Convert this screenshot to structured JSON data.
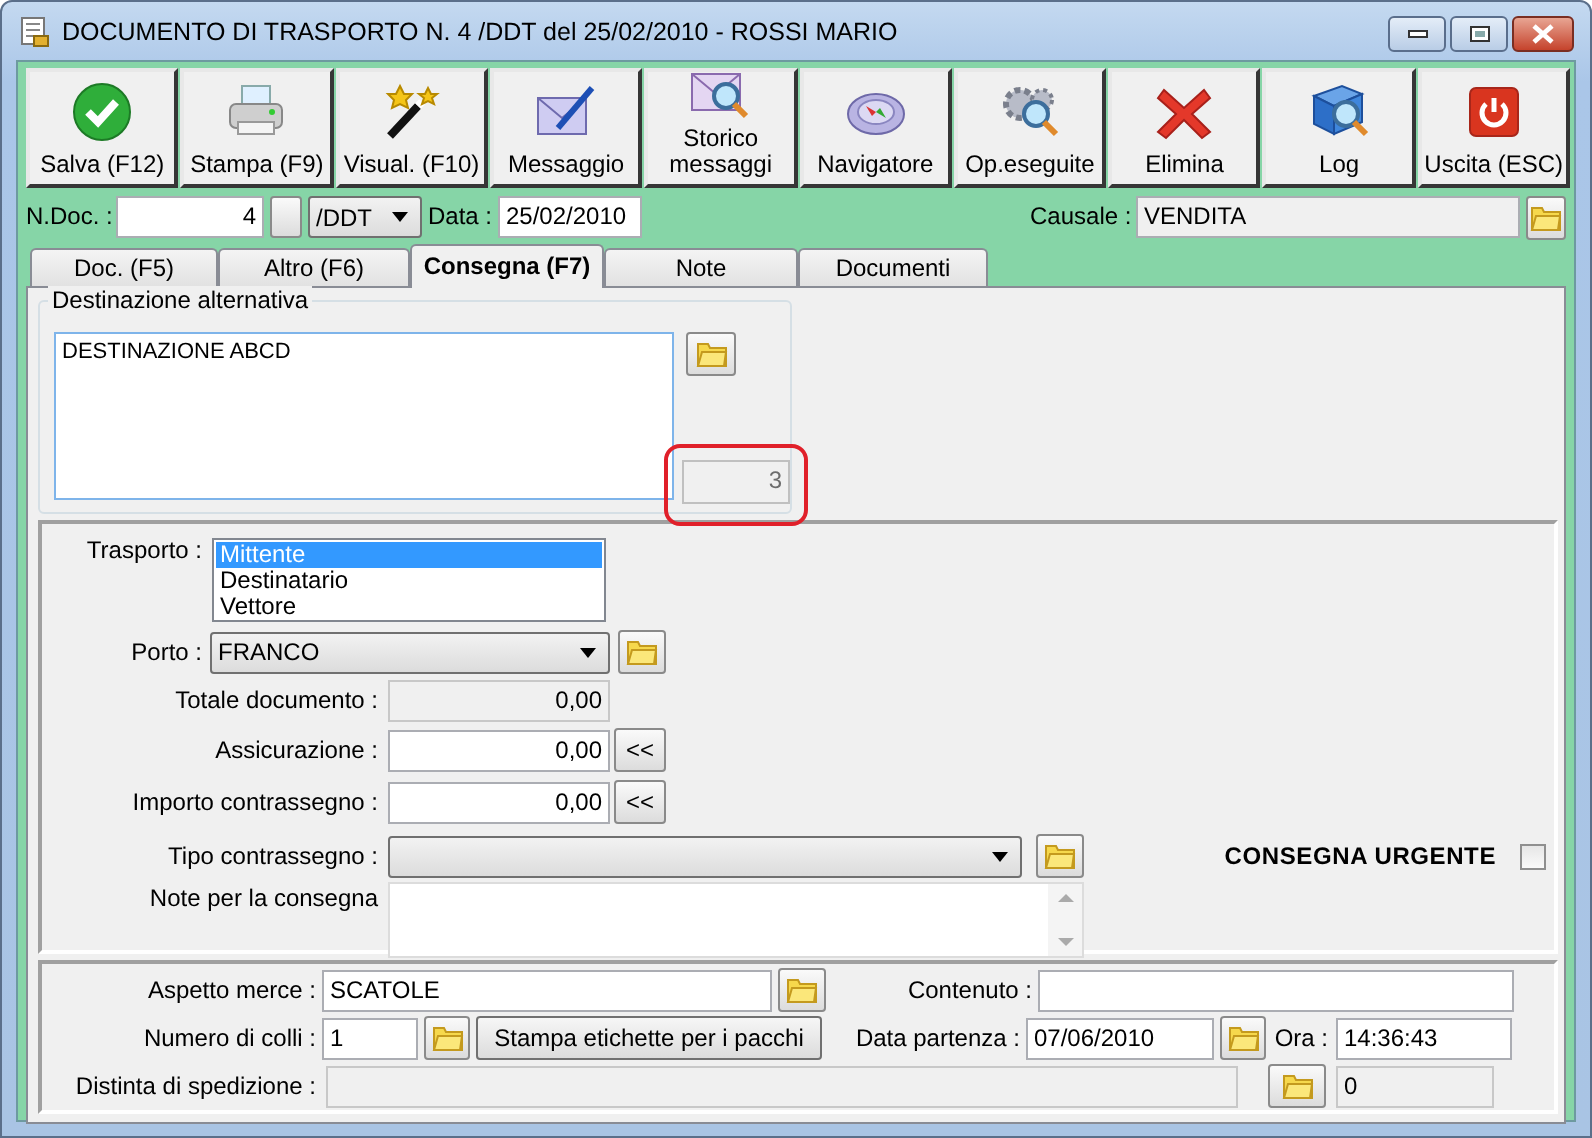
{
  "window": {
    "title": "DOCUMENTO DI TRASPORTO N. 4 /DDT del 25/02/2010 - ROSSI MARIO"
  },
  "toolbar": [
    {
      "label": "Salva (F12)",
      "kind": "save"
    },
    {
      "label": "Stampa (F9)",
      "kind": "print"
    },
    {
      "label": "Visual. (F10)",
      "kind": "view"
    },
    {
      "label": "Messaggio",
      "kind": "message"
    },
    {
      "label": "Storico messaggi",
      "kind": "history"
    },
    {
      "label": "Navigatore",
      "kind": "navigator"
    },
    {
      "label": "Op.eseguite",
      "kind": "operations"
    },
    {
      "label": "Elimina",
      "kind": "delete"
    },
    {
      "label": "Log",
      "kind": "log"
    },
    {
      "label": "Uscita (ESC)",
      "kind": "exit"
    }
  ],
  "header": {
    "ndoc_label": "N.Doc. :",
    "ndoc": "4",
    "series": "/DDT",
    "date_label": "Data :",
    "date": "25/02/2010",
    "causale_label": "Causale :",
    "causale": "VENDITA"
  },
  "tabs": [
    {
      "label": "Doc. (F5)",
      "selected": false
    },
    {
      "label": "Altro (F6)",
      "selected": false
    },
    {
      "label": "Consegna (F7)",
      "selected": true
    },
    {
      "label": "Note",
      "selected": false
    },
    {
      "label": "Documenti",
      "selected": false
    }
  ],
  "destinazione": {
    "legend": "Destinazione alternativa",
    "text": "DESTINAZIONE ABCD",
    "count": "3"
  },
  "trasporto": {
    "label": "Trasporto :",
    "options": [
      {
        "label": "Mittente",
        "selected": true
      },
      {
        "label": "Destinatario",
        "selected": false
      },
      {
        "label": "Vettore",
        "selected": false
      }
    ]
  },
  "porto": {
    "label": "Porto :",
    "value": "FRANCO"
  },
  "amounts": [
    {
      "label": "Totale documento :",
      "value": "0,00",
      "kind": "readonly"
    },
    {
      "label": "Assicurazione :",
      "value": "0,00",
      "kind": "button",
      "button": "<<"
    },
    {
      "label": "Importo contrassegno :",
      "value": "0,00",
      "kind": "button",
      "button": "<<"
    }
  ],
  "tipo_contrassegno": {
    "label": "Tipo contrassegno :"
  },
  "note": {
    "label": "Note per la consegna"
  },
  "urgent": {
    "label": "CONSEGNA URGENTE",
    "checked": false
  },
  "shipping": {
    "aspetto_label": "Aspetto merce :",
    "aspetto": "SCATOLE",
    "contenuto_label": "Contenuto :",
    "colli_label": "Numero di colli :",
    "colli": "1",
    "print_button": "Stampa etichette per i pacchi",
    "data_label": "Data partenza :",
    "data": "07/06/2010",
    "ora_label": "Ora :",
    "ora": "14:36:43",
    "distinta_label": "Distinta di spedizione :",
    "distinta_count": "0"
  }
}
